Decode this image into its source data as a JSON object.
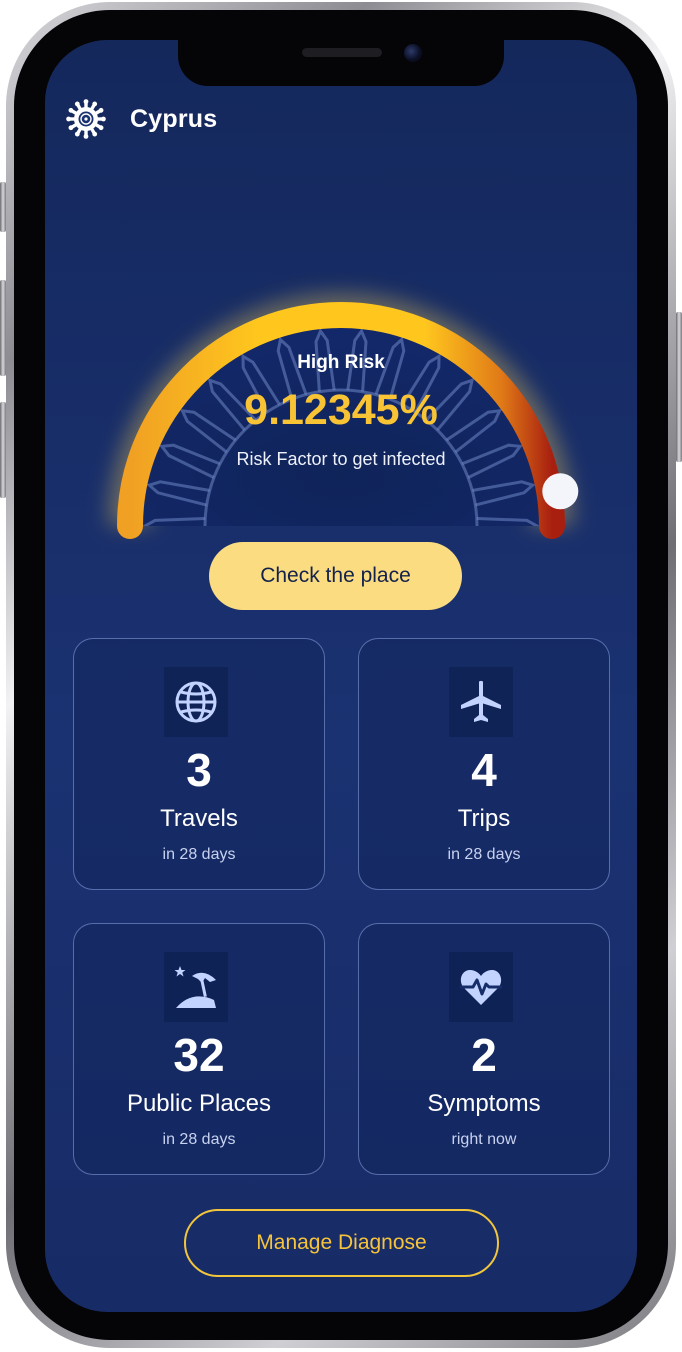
{
  "header": {
    "country": "Cyprus",
    "logo_icon": "virus-icon"
  },
  "risk": {
    "level_label": "High Risk",
    "value": "9.12345%",
    "caption": "Risk Factor to get infected",
    "gauge_fraction": 0.95,
    "colors": {
      "start": "#f4a321",
      "mid": "#ffc21c",
      "end": "#b0230f",
      "value_text": "#f8c334"
    }
  },
  "actions": {
    "check_place": "Check the place",
    "manage_diagnose": "Manage Diagnose"
  },
  "stats": [
    {
      "icon": "globe-icon",
      "count": "3",
      "label": "Travels",
      "sub": "in 28 days"
    },
    {
      "icon": "airplane-icon",
      "count": "4",
      "label": "Trips",
      "sub": "in 28 days"
    },
    {
      "icon": "beach-umbrella-icon",
      "count": "32",
      "label": "Public Places",
      "sub": "in 28 days"
    },
    {
      "icon": "heart-pulse-icon",
      "count": "2",
      "label": "Symptoms",
      "sub": "right now"
    }
  ],
  "theme": {
    "background": "#1b3272",
    "accent_yellow": "#fcdc80",
    "icon_color": "#c3d3ff"
  }
}
